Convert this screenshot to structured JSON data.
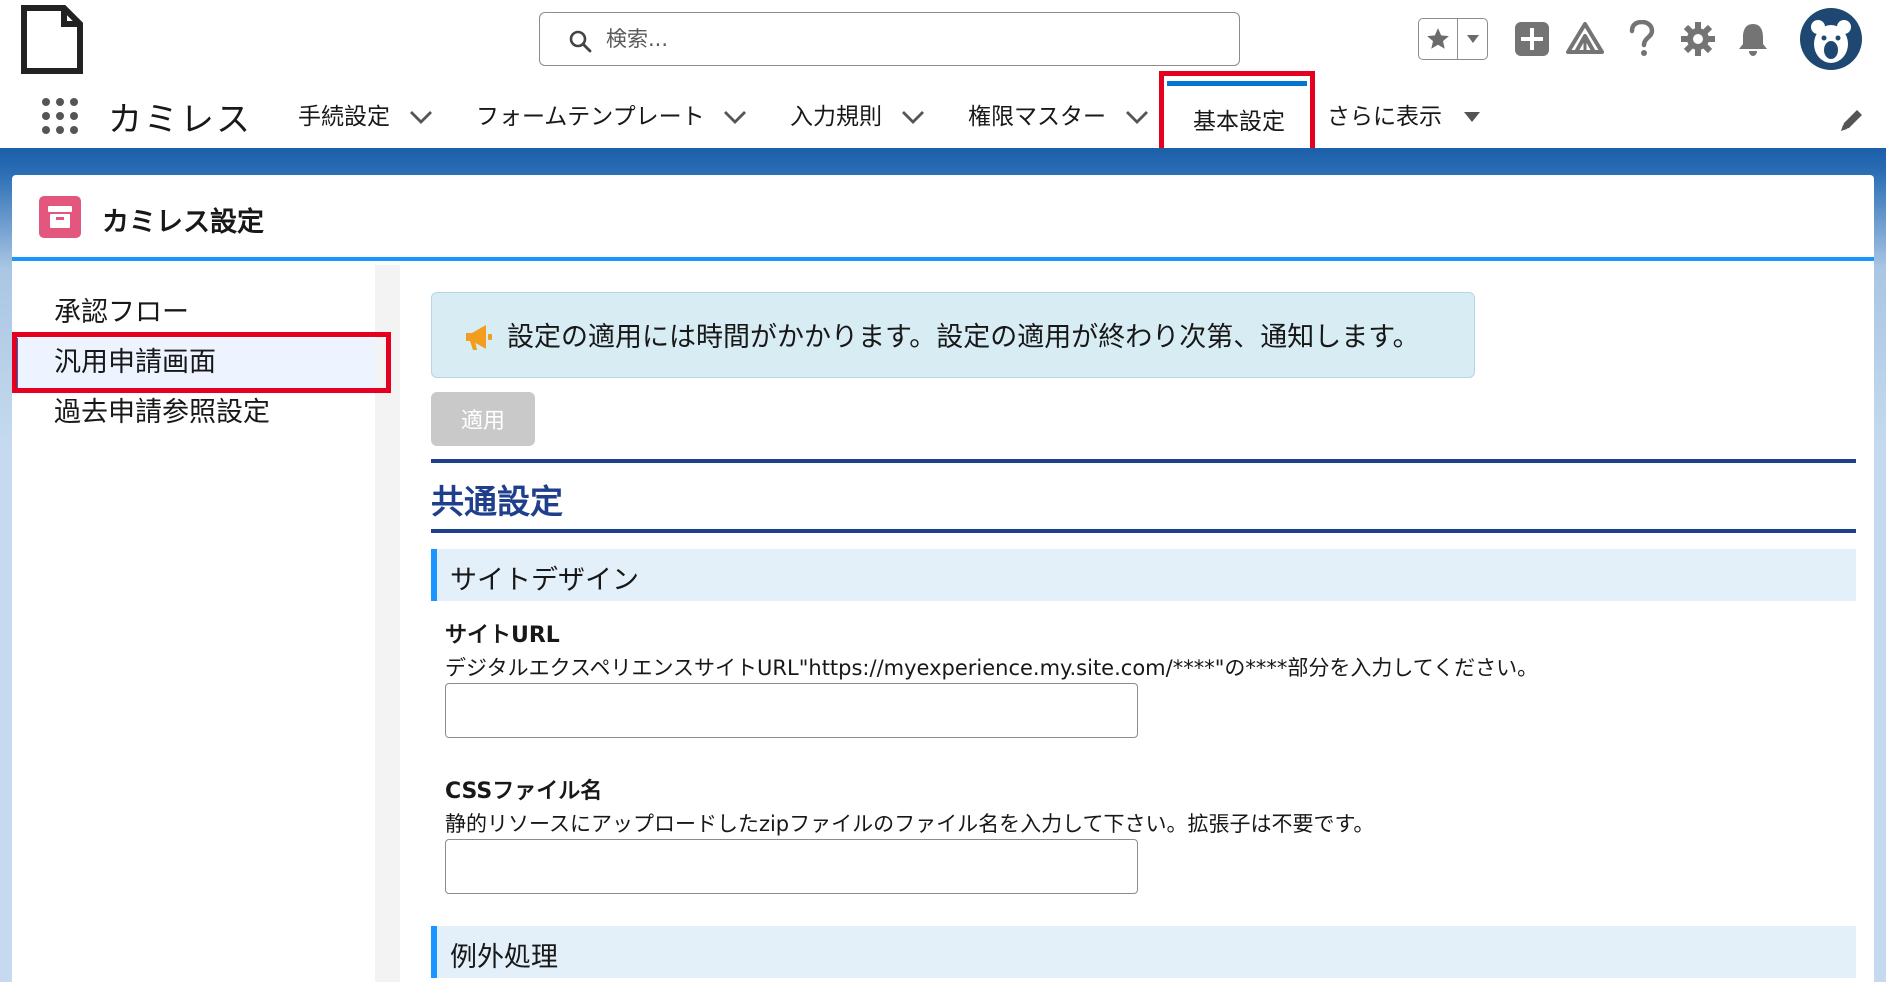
{
  "header": {
    "search": {
      "placeholder": "検索..."
    }
  },
  "nav": {
    "app_name": "カミレス",
    "items": [
      {
        "label": "手続設定",
        "has_menu": true
      },
      {
        "label": "フォームテンプレート",
        "has_menu": true
      },
      {
        "label": "入力規則",
        "has_menu": true
      },
      {
        "label": "権限マスター",
        "has_menu": true
      },
      {
        "label": "基本設定",
        "active": true
      },
      {
        "label": "さらに表示",
        "has_menu": true
      }
    ]
  },
  "page": {
    "title": "カミレス設定"
  },
  "sidebar": {
    "items": [
      {
        "label": "承認フロー"
      },
      {
        "label": "汎用申請画面",
        "active": true
      },
      {
        "label": "過去申請参照設定"
      }
    ]
  },
  "main": {
    "notice": "設定の適用には時間がかかります。設定の適用が終わり次第、通知します。",
    "apply_label": "適用",
    "section_title": "共通設定",
    "groups": [
      {
        "title": "サイトデザイン",
        "fields": [
          {
            "label": "サイトURL",
            "help": "デジタルエクスペリエンスサイトURL\"https://myexperience.my.site.com/****\"の****部分を入力してください。",
            "value": ""
          },
          {
            "label": "CSSファイル名",
            "help": "静的リソースにアップロードしたzipファイルのファイル名を入力して下さい。拡張子は不要です。",
            "value": ""
          }
        ]
      },
      {
        "title": "例外処理"
      }
    ]
  },
  "colors": {
    "brand_blue": "#0176d3",
    "section_navy": "#1f3e8c",
    "highlight_red": "#e6001f",
    "notice_bg": "#d8ecf4"
  }
}
